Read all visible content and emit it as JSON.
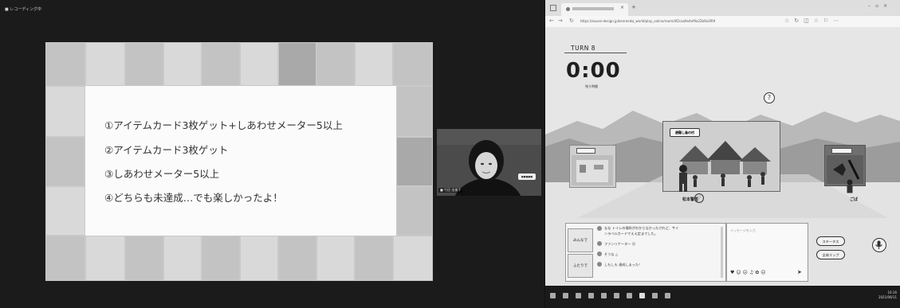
{
  "meeting": {
    "title": "■ レコーディング中",
    "slide": {
      "conditions": [
        "①アイテムカード3枚ゲット+しあわせメーター5以上",
        "②アイテムカード3枚ゲット",
        "③しあわせメーター5以上",
        "④どちらも未達成…でも楽しかったよ！"
      ]
    },
    "video": {
      "name": "■ 竹田 由美子",
      "badge": "■■■■■"
    }
  },
  "browser": {
    "url": "https://sousei-design.jp/kenmeika_world/play_online/room/4f2caa9e4ef9a22b9a3f09",
    "game": {
      "turn": "TURN 8",
      "timer": "0:00",
      "timer_sub": "残り時間",
      "help": "?",
      "card_center_title": "避難し島の村",
      "card_left_title": "",
      "card_right_title": "",
      "center_label": "松本警笛",
      "right_label": "ごば",
      "chat_tabs": [
        "みんなで",
        "ふたりで"
      ],
      "messages": [
        "なな トイレの場所がわからなかったけれど、サイ",
        "ンラベルカードでええ定までした。",
        "ファンリナーター ☺",
        "そうな △",
        "しもしも 達成しまった！"
      ],
      "message_placeholder": "メッセージを入力",
      "status_button": "ステータス",
      "map_button": "全体マップ"
    },
    "taskbar": {
      "time": "10:16",
      "date": "2021/09/11"
    }
  }
}
